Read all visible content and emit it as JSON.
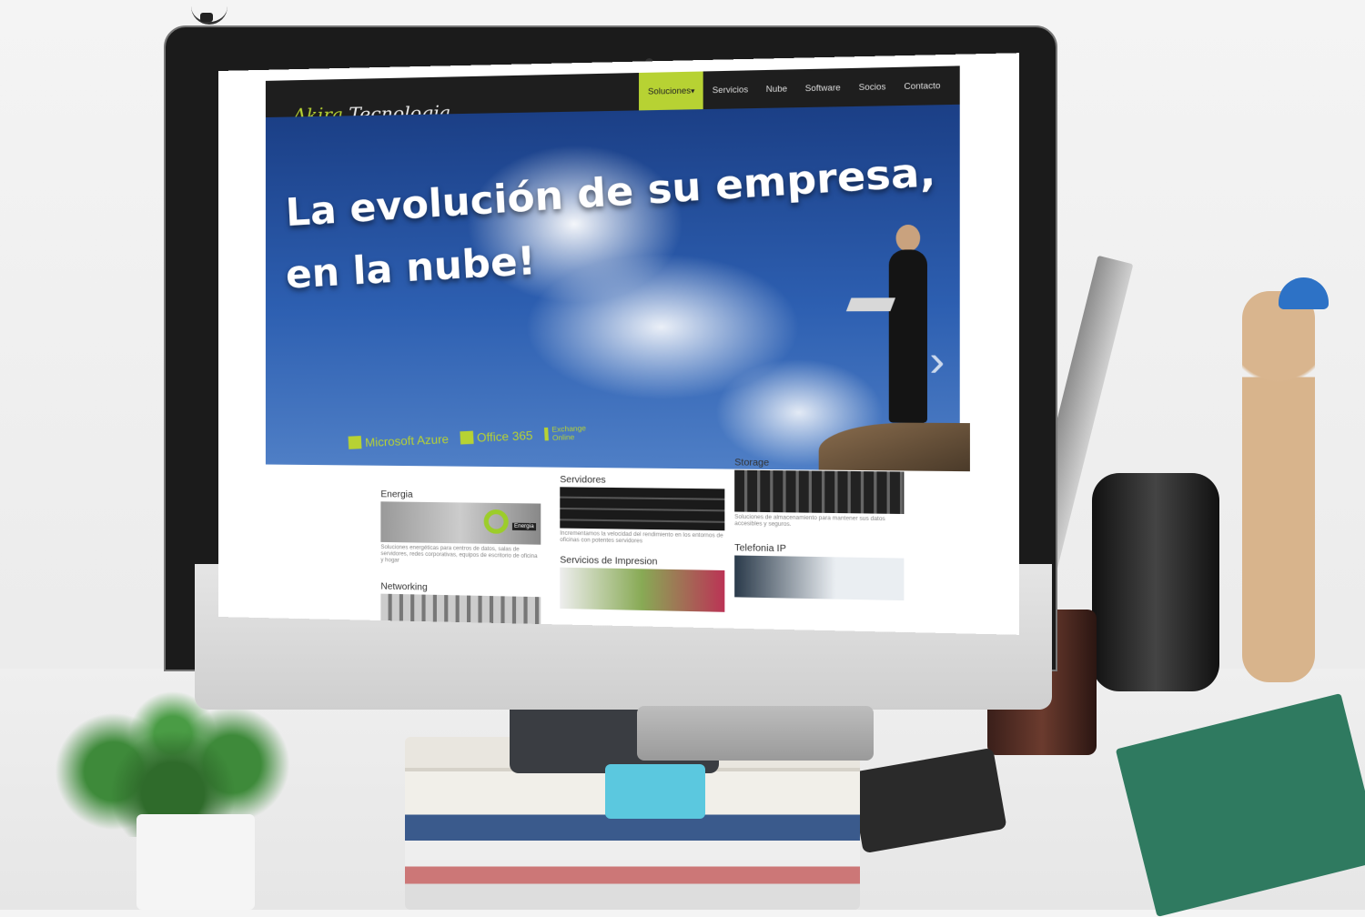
{
  "site": {
    "logo": {
      "word1": "Akira",
      "word2": "Tecnologia"
    },
    "nav": [
      {
        "label": "Soluciones",
        "active": true,
        "has_dropdown": true
      },
      {
        "label": "Servicios"
      },
      {
        "label": "Nube"
      },
      {
        "label": "Software"
      },
      {
        "label": "Socios"
      },
      {
        "label": "Contacto"
      }
    ],
    "hero": {
      "line1": "La evolución de su empresa,",
      "line2": "en la nube!",
      "brands": [
        "Microsoft Azure",
        "Office 365",
        "Exchange Online"
      ]
    },
    "services": [
      {
        "title": "Energia",
        "desc": "Soluciones energéticas para centros de datos, salas de servidores, redes corporativas, equipos de escritorio de oficina y hogar",
        "tag": "Energia"
      },
      {
        "title": "Servidores",
        "desc": "Incrementamos la velocidad del rendimiento en los entornos de oficinas con potentes servidores"
      },
      {
        "title": "Storage",
        "desc": "Soluciones de almacenamiento para mantener sus datos accesibles y seguros."
      },
      {
        "title": "Servicios de Impresion",
        "desc": ""
      },
      {
        "title": "Telefonia IP",
        "desc": ""
      },
      {
        "title": "Networking",
        "desc": ""
      }
    ]
  },
  "colors": {
    "accent": "#b7d233",
    "navbar": "#1e1e1e",
    "sky": "#2d5fb1"
  },
  "icons": [
    "apple-logo-icon",
    "windows-icon",
    "office-icon",
    "exchange-icon",
    "next-arrow-icon",
    "search-icon"
  ]
}
